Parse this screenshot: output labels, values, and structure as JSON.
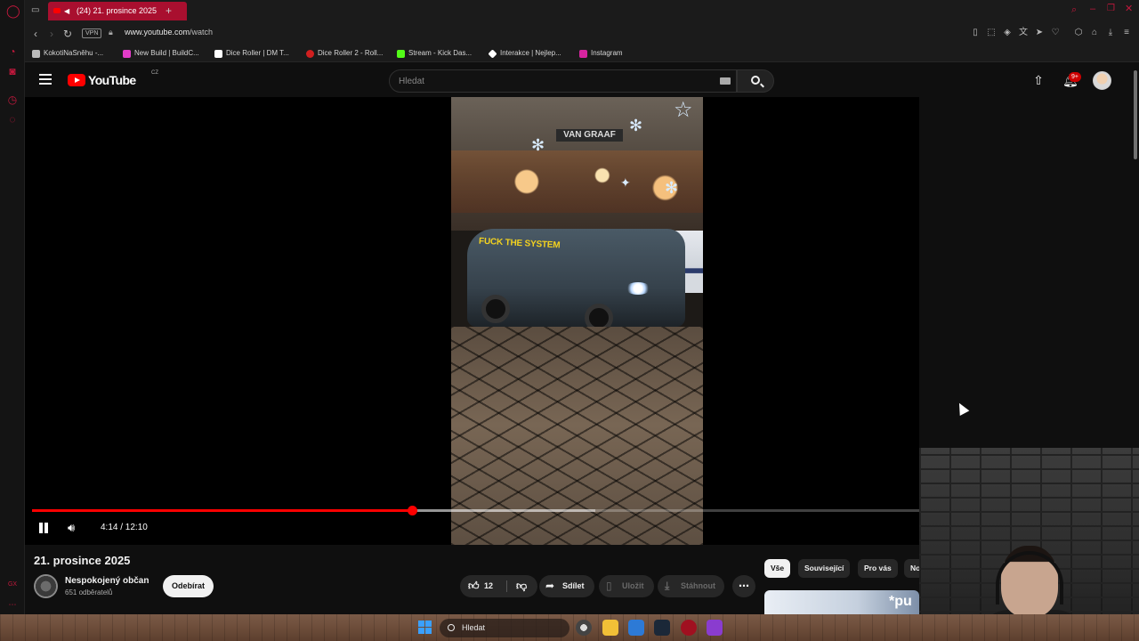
{
  "browser": {
    "tab_title": "(24) 21. prosince 2025",
    "url_host": "www.youtube.com",
    "url_path": "/watch",
    "vpn_label": "VPN",
    "bookmarks": [
      {
        "label": "KokotiNaSněhu -...",
        "color": "#bbbbbb"
      },
      {
        "label": "New Build | BuildC...",
        "color": "#e23cc8"
      },
      {
        "label": "Dice Roller | DM T...",
        "color": "#ffffff"
      },
      {
        "label": "Dice Roller 2 - Roll...",
        "color": "#d01f1f"
      },
      {
        "label": "Stream - Kick Das...",
        "color": "#53fc18"
      },
      {
        "label": "Interakce | Nejlep...",
        "color": "#ffffff"
      },
      {
        "label": "Instagram",
        "color": "#d6249f"
      }
    ]
  },
  "youtube": {
    "logo_text": "YouTube",
    "country_code": "CZ",
    "search_placeholder": "Hledat",
    "notification_count": "9+"
  },
  "player": {
    "current_time": "4:14",
    "duration": "12:10",
    "time_display": "4:14 / 12:10",
    "played_fraction": 0.428,
    "buffered_fraction": 0.635,
    "video_sign_text": "VAN GRAAF",
    "video_van_text": "FUCK THE SYSTEM"
  },
  "video": {
    "title": "21. prosince 2025",
    "channel_name": "Nespokojený občan",
    "subscribers": "651 odběratelů",
    "subscribe_label": "Odebírat",
    "like_count": "12",
    "share_label": "Sdílet",
    "save_label": "Uložit",
    "download_label": "Stáhnout"
  },
  "sidebar_chips": [
    {
      "label": "Vše",
      "active": true
    },
    {
      "label": "Související",
      "active": false
    },
    {
      "label": "Pro vás",
      "active": false
    },
    {
      "label": "No",
      "active": false
    }
  ],
  "recommendation_thumb_text": "*pu",
  "taskbar": {
    "search_label": "Hledat"
  },
  "colors": {
    "opera_red": "#c2183c",
    "youtube_red": "#ff0000",
    "active_tab": "#a90f2f"
  }
}
